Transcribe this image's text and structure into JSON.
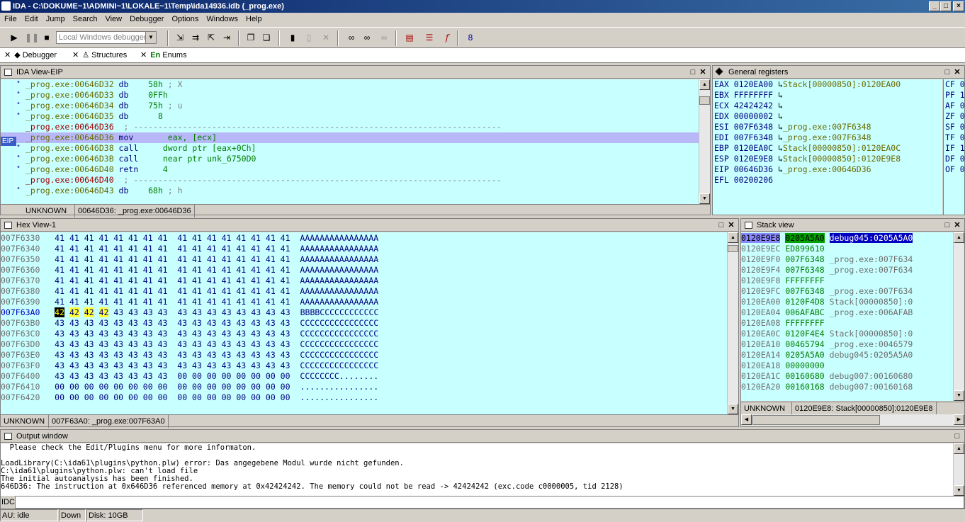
{
  "window": {
    "title": "IDA - C:\\DOKUME~1\\ADMINI~1\\LOKALE~1\\Temp\\ida14936.idb (_prog.exe)"
  },
  "menu": [
    "File",
    "Edit",
    "Jump",
    "Search",
    "View",
    "Debugger",
    "Options",
    "Windows",
    "Help"
  ],
  "toolbar": {
    "debugger_select": "Local Windows debugger"
  },
  "tabs": [
    {
      "label": "Debugger"
    },
    {
      "label": "Structures"
    },
    {
      "label": "Enums"
    }
  ],
  "ida_view": {
    "title": "IDA View-EIP",
    "eip_label": "EIP",
    "lines": [
      {
        "addr": "_prog.exe:00646D32",
        "mnem": "db",
        "op": "58h",
        "cmt": "; X",
        "dot": true
      },
      {
        "addr": "_prog.exe:00646D33",
        "mnem": "db",
        "op": "0FFh",
        "cmt": "",
        "dot": true
      },
      {
        "addr": "_prog.exe:00646D34",
        "mnem": "db",
        "op": "75h",
        "cmt": "; u",
        "dot": true
      },
      {
        "addr": "_prog.exe:00646D35",
        "mnem": "db",
        "op": "  8",
        "cmt": "",
        "dot": true
      },
      {
        "addr": "_prog.exe:00646D36",
        "mnem": "",
        "op": "",
        "cmt": "; ---------------------------------------------------------------------------",
        "dot": false,
        "red": true
      },
      {
        "addr": "_prog.exe:00646D36",
        "mnem": "mov",
        "op": "    eax, [ecx]",
        "cmt": "",
        "dot": false,
        "highlight": true
      },
      {
        "addr": "_prog.exe:00646D38",
        "mnem": "call",
        "op": "   dword ptr [eax+0Ch]",
        "cmt": "",
        "dot": true
      },
      {
        "addr": "_prog.exe:00646D3B",
        "mnem": "call",
        "op": "   near ptr unk_6750D0",
        "cmt": "",
        "dot": true
      },
      {
        "addr": "_prog.exe:00646D40",
        "mnem": "retn",
        "op": "   4",
        "cmt": "",
        "dot": true
      },
      {
        "addr": "_prog.exe:00646D40",
        "mnem": "",
        "op": "",
        "cmt": "; ---------------------------------------------------------------------------",
        "dot": false,
        "red": true
      },
      {
        "addr": "_prog.exe:00646D43",
        "mnem": "db",
        "op": "68h",
        "cmt": "; h",
        "dot": true
      }
    ],
    "status_left": "UNKNOWN",
    "status_right": "00646D36: _prog.exe:00646D36"
  },
  "registers": {
    "title": "General registers",
    "rows": [
      {
        "name": "EAX",
        "val": "0120EA00",
        "ref": "Stack[00000850]:0120EA00",
        "flag": "CF 0"
      },
      {
        "name": "EBX",
        "val": "FFFFFFFF",
        "ref": "",
        "flag": "PF 1"
      },
      {
        "name": "ECX",
        "val": "42424242",
        "ref": "",
        "flag": "AF 0"
      },
      {
        "name": "EDX",
        "val": "00000002",
        "ref": "",
        "flag": "ZF 0"
      },
      {
        "name": "ESI",
        "val": "007F6348",
        "ref": "_prog.exe:007F6348",
        "flag": "SF 0"
      },
      {
        "name": "EDI",
        "val": "007F6348",
        "ref": "_prog.exe:007F6348",
        "flag": "TF 0"
      },
      {
        "name": "EBP",
        "val": "0120EA0C",
        "ref": "Stack[00000850]:0120EA0C",
        "flag": "IF 1"
      },
      {
        "name": "ESP",
        "val": "0120E9E8",
        "ref": "Stack[00000850]:0120E9E8",
        "flag": "DF 0"
      },
      {
        "name": "EIP",
        "val": "00646D36",
        "ref": "_prog.exe:00646D36",
        "flag": "OF 0"
      },
      {
        "name": "EFL",
        "val": "00200206",
        "ref": "",
        "flag": ""
      }
    ]
  },
  "hex_view": {
    "title": "Hex View-1",
    "rows": [
      {
        "addr": "007F6330",
        "h1": "41 41 41 41 41 41 41 41",
        "h2": "41 41 41 41 41 41 41 41",
        "asc": "AAAAAAAAAAAAAAAA"
      },
      {
        "addr": "007F6340",
        "h1": "41 41 41 41 41 41 41 41",
        "h2": "41 41 41 41 41 41 41 41",
        "asc": "AAAAAAAAAAAAAAAA"
      },
      {
        "addr": "007F6350",
        "h1": "41 41 41 41 41 41 41 41",
        "h2": "41 41 41 41 41 41 41 41",
        "asc": "AAAAAAAAAAAAAAAA"
      },
      {
        "addr": "007F6360",
        "h1": "41 41 41 41 41 41 41 41",
        "h2": "41 41 41 41 41 41 41 41",
        "asc": "AAAAAAAAAAAAAAAA"
      },
      {
        "addr": "007F6370",
        "h1": "41 41 41 41 41 41 41 41",
        "h2": "41 41 41 41 41 41 41 41",
        "asc": "AAAAAAAAAAAAAAAA"
      },
      {
        "addr": "007F6380",
        "h1": "41 41 41 41 41 41 41 41",
        "h2": "41 41 41 41 41 41 41 41",
        "asc": "AAAAAAAAAAAAAAAA"
      },
      {
        "addr": "007F6390",
        "h1": "41 41 41 41 41 41 41 41",
        "h2": "41 41 41 41 41 41 41 41",
        "asc": "AAAAAAAAAAAAAAAA"
      },
      {
        "addr": "007F63A0",
        "h1": "42 42 42 42 43 43 43 43",
        "h2": "43 43 43 43 43 43 43 43",
        "asc": "BBBBCCCCCCCCCCCC",
        "current": true
      },
      {
        "addr": "007F63B0",
        "h1": "43 43 43 43 43 43 43 43",
        "h2": "43 43 43 43 43 43 43 43",
        "asc": "CCCCCCCCCCCCCCCC"
      },
      {
        "addr": "007F63C0",
        "h1": "43 43 43 43 43 43 43 43",
        "h2": "43 43 43 43 43 43 43 43",
        "asc": "CCCCCCCCCCCCCCCC"
      },
      {
        "addr": "007F63D0",
        "h1": "43 43 43 43 43 43 43 43",
        "h2": "43 43 43 43 43 43 43 43",
        "asc": "CCCCCCCCCCCCCCCC"
      },
      {
        "addr": "007F63E0",
        "h1": "43 43 43 43 43 43 43 43",
        "h2": "43 43 43 43 43 43 43 43",
        "asc": "CCCCCCCCCCCCCCCC"
      },
      {
        "addr": "007F63F0",
        "h1": "43 43 43 43 43 43 43 43",
        "h2": "43 43 43 43 43 43 43 43",
        "asc": "CCCCCCCCCCCCCCCC"
      },
      {
        "addr": "007F6400",
        "h1": "43 43 43 43 43 43 43 43",
        "h2": "00 00 00 00 00 00 00 00",
        "asc": "CCCCCCCC........"
      },
      {
        "addr": "007F6410",
        "h1": "00 00 00 00 00 00 00 00",
        "h2": "00 00 00 00 00 00 00 00",
        "asc": "................"
      },
      {
        "addr": "007F6420",
        "h1": "00 00 00 00 00 00 00 00",
        "h2": "00 00 00 00 00 00 00 00",
        "asc": "................"
      }
    ],
    "status_left": "UNKNOWN",
    "status_right": "007F63A0: _prog.exe:007F63A0"
  },
  "stack_view": {
    "title": "Stack view",
    "rows": [
      {
        "addr": "0120E9E8",
        "val": "0205A5A0",
        "ref": "debug045:0205A5A0",
        "current": true
      },
      {
        "addr": "0120E9EC",
        "val": "ED899610",
        "ref": ""
      },
      {
        "addr": "0120E9F0",
        "val": "007F6348",
        "ref": "_prog.exe:007F634"
      },
      {
        "addr": "0120E9F4",
        "val": "007F6348",
        "ref": "_prog.exe:007F634"
      },
      {
        "addr": "0120E9F8",
        "val": "FFFFFFFF",
        "ref": ""
      },
      {
        "addr": "0120E9FC",
        "val": "007F6348",
        "ref": "_prog.exe:007F634"
      },
      {
        "addr": "0120EA00",
        "val": "0120F4D8",
        "ref": "Stack[00000850]:0"
      },
      {
        "addr": "0120EA04",
        "val": "006AFABC",
        "ref": "_prog.exe:006AFAB"
      },
      {
        "addr": "0120EA08",
        "val": "FFFFFFFF",
        "ref": ""
      },
      {
        "addr": "0120EA0C",
        "val": "0120F4E4",
        "ref": "Stack[00000850]:0"
      },
      {
        "addr": "0120EA10",
        "val": "00465794",
        "ref": "_prog.exe:0046579"
      },
      {
        "addr": "0120EA14",
        "val": "0205A5A0",
        "ref": "debug045:0205A5A0"
      },
      {
        "addr": "0120EA18",
        "val": "00000000",
        "ref": ""
      },
      {
        "addr": "0120EA1C",
        "val": "00160680",
        "ref": "debug007:00160680"
      },
      {
        "addr": "0120EA20",
        "val": "00160168",
        "ref": "debug007:00160168"
      }
    ],
    "status_left": "UNKNOWN",
    "status_right": "0120E9E8: Stack[00000850]:0120E9E8"
  },
  "output": {
    "title": "Output window",
    "lines": [
      "  Please check the Edit/Plugins menu for more informaton.",
      "",
      "LoadLibrary(C:\\ida61\\plugins\\python.plw) error: Das angegebene Modul wurde nicht gefunden.",
      "C:\\ida61\\plugins\\python.plw: can't load file",
      "The initial autoanalysis has been finished.",
      "646D36: The instruction at 0x646D36 referenced memory at 0x42424242. The memory could not be read -> 42424242 (exc.code c0000005, tid 2128)"
    ],
    "idc_label": "IDC",
    "idc_value": ""
  },
  "statusbar": {
    "au": "AU:  idle",
    "dir": "Down",
    "disk": "Disk: 10GB"
  }
}
